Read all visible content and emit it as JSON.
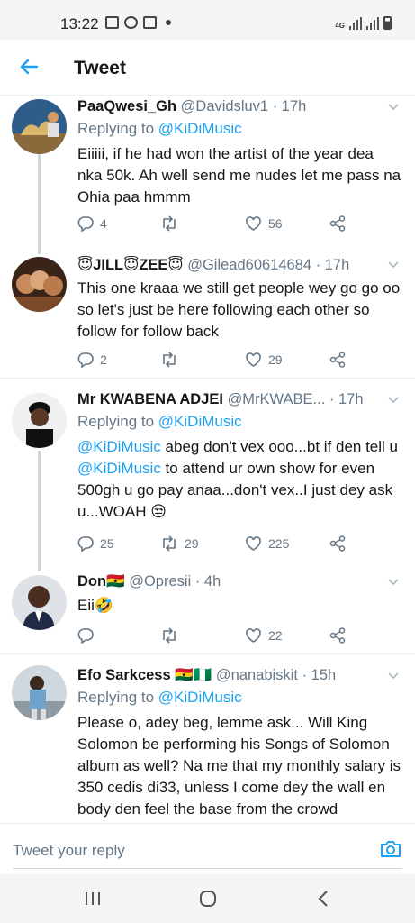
{
  "status_bar": {
    "time": "13:22",
    "network": "4G"
  },
  "header": {
    "title": "Tweet"
  },
  "tweets": [
    {
      "name": "PaaQwesi_Gh",
      "handle": "@Davidsluv1",
      "time": "· 17h",
      "replying_prefix": "Replying to",
      "replying_to": "@KiDiMusic",
      "text": "Eiiiii, if he had won the artist of the year dea nka 50k. Ah well send me nudes let me pass na Ohia paa hmmm",
      "replies": "4",
      "retweets": "",
      "likes": "56"
    },
    {
      "name_prefix": "😇",
      "name": "JILL😇ZEE😇",
      "handle": "@Gilead60614684",
      "time": "· 17h",
      "text": "This one kraaa we still get people wey go go oo so let's just be here following each other so follow for follow back",
      "replies": "2",
      "retweets": "",
      "likes": "29"
    },
    {
      "name": "Mr KWABENA ADJEI",
      "handle": "@MrKWABE...",
      "time": "· 17h",
      "replying_prefix": "Replying to",
      "replying_to": "@KiDiMusic",
      "text_mention_1": "@KiDiMusic",
      "text_part_1": " abeg don't vex ooo...bt if den tell u ",
      "text_mention_2": "@KiDiMusic",
      "text_part_2": " to attend ur own show for even 500gh u go pay anaa...don't vex..I just dey ask u...WOAH 😒",
      "replies": "25",
      "retweets": "29",
      "likes": "225"
    },
    {
      "name": "Don🇬🇭",
      "handle": "@Opresii",
      "time": "· 4h",
      "text": "Eii🤣",
      "replies": "",
      "retweets": "",
      "likes": "22"
    },
    {
      "name": "Efo Sarkcess 🇬🇭🇳🇬",
      "handle": "@nanabiskit",
      "time": "· 15h",
      "replying_prefix": "Replying to",
      "replying_to": "@KiDiMusic",
      "text": "Please o, adey beg, lemme ask... Will King Solomon be performing his Songs of Solomon album as well? Na me that my monthly salary is 350 cedis di33, unless I come dey the wall en body den feel the base from the crowd"
    }
  ],
  "reply_bar": {
    "placeholder": "Tweet your reply"
  },
  "colors": {
    "accent": "#1da1f2",
    "secondary_text": "#657786",
    "divider": "#e6ecf0"
  },
  "icons": [
    "back-arrow-icon",
    "chevron-down-icon",
    "reply-icon",
    "retweet-icon",
    "like-icon",
    "share-icon",
    "camera-icon",
    "recent-apps-icon",
    "home-icon",
    "back-icon"
  ]
}
